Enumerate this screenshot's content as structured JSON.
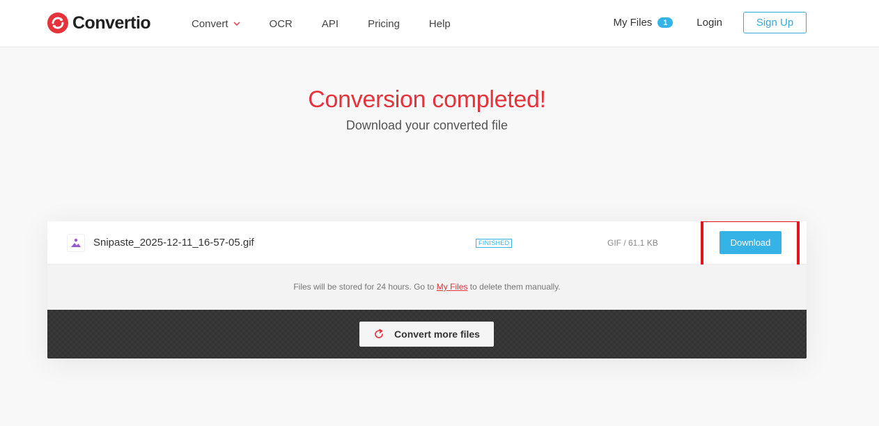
{
  "header": {
    "logo_text": "Convertio",
    "nav": [
      {
        "label": "Convert"
      },
      {
        "label": "OCR"
      },
      {
        "label": "API"
      },
      {
        "label": "Pricing"
      },
      {
        "label": "Help"
      }
    ],
    "my_files_label": "My Files",
    "my_files_count": "1",
    "login_label": "Login",
    "signup_label": "Sign Up"
  },
  "hero": {
    "title": "Conversion completed!",
    "subtitle": "Download your converted file"
  },
  "file": {
    "icon": "image-file-icon",
    "name": "Snipaste_2025-12-11_16-57-05.gif",
    "status": "FINISHED",
    "meta": "GIF / 61.1 KB",
    "download_label": "Download"
  },
  "storage_note": {
    "before": "Files will be stored for 24 hours. Go to ",
    "link": "My Files",
    "after": " to delete them manually."
  },
  "convert_more_label": "Convert more files",
  "colors": {
    "brand_red": "#e5323b",
    "accent_blue": "#35b2e6",
    "highlight_red": "#e0131f"
  }
}
